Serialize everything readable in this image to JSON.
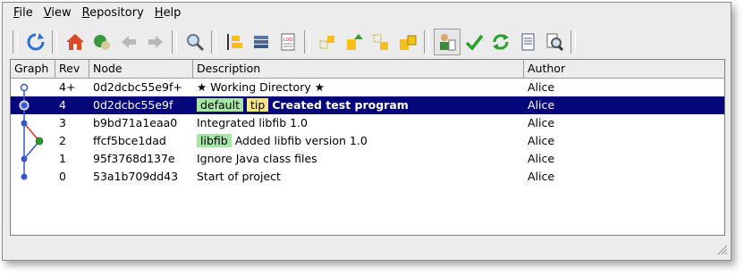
{
  "menu": [
    "File",
    "View",
    "Repository",
    "Help"
  ],
  "menu_underline": [
    "F",
    "V",
    "R",
    "H"
  ],
  "toolbar_icons": [
    "refresh-icon",
    "home-icon",
    "pull-icon",
    "back-arrow-icon",
    "forward-arrow-icon",
    "search-icon",
    "branch-graph-icon",
    "stack-icon",
    "log-icon",
    "merge-icon",
    "commit-up-icon",
    "update-icon",
    "push-icon",
    "user-icon",
    "check-icon",
    "sync-icon",
    "document-icon",
    "inspect-icon"
  ],
  "columns": {
    "graph": "Graph",
    "rev": "Rev",
    "node": "Node",
    "desc": "Description",
    "author": "Author"
  },
  "rows": [
    {
      "rev": "4+",
      "node": "0d2dcbc55e9f+",
      "desc": "★ Working Directory ★",
      "author": "Alice",
      "tags": [],
      "selected": false,
      "bold": false
    },
    {
      "rev": "4",
      "node": "0d2dcbc55e9f",
      "desc": "Created test program",
      "author": "Alice",
      "tags": [
        {
          "label": "default",
          "kind": "branch"
        },
        {
          "label": "tip",
          "kind": "tip"
        }
      ],
      "selected": true,
      "bold": true
    },
    {
      "rev": "3",
      "node": "b9bd71a1eaa0",
      "desc": "Integrated libfib 1.0",
      "author": "Alice",
      "tags": [],
      "selected": false,
      "bold": false
    },
    {
      "rev": "2",
      "node": "ffcf5bce1dad",
      "desc": "Added libfib version 1.0",
      "author": "Alice",
      "tags": [
        {
          "label": "libfib",
          "kind": "branch"
        }
      ],
      "selected": false,
      "bold": false
    },
    {
      "rev": "1",
      "node": "95f3768d137e",
      "desc": "Ignore Java class files",
      "author": "Alice",
      "tags": [],
      "selected": false,
      "bold": false
    },
    {
      "rev": "0",
      "node": "53a1b709dd43",
      "desc": "Start of project",
      "author": "Alice",
      "tags": [],
      "selected": false,
      "bold": false
    }
  ],
  "colors": {
    "selection": "#04067a",
    "branch_tag": "#a8e6a8",
    "tip_tag": "#f7e38a",
    "graph_blue": "#3a55c8",
    "graph_red": "#e03030",
    "graph_green": "#22a022"
  }
}
